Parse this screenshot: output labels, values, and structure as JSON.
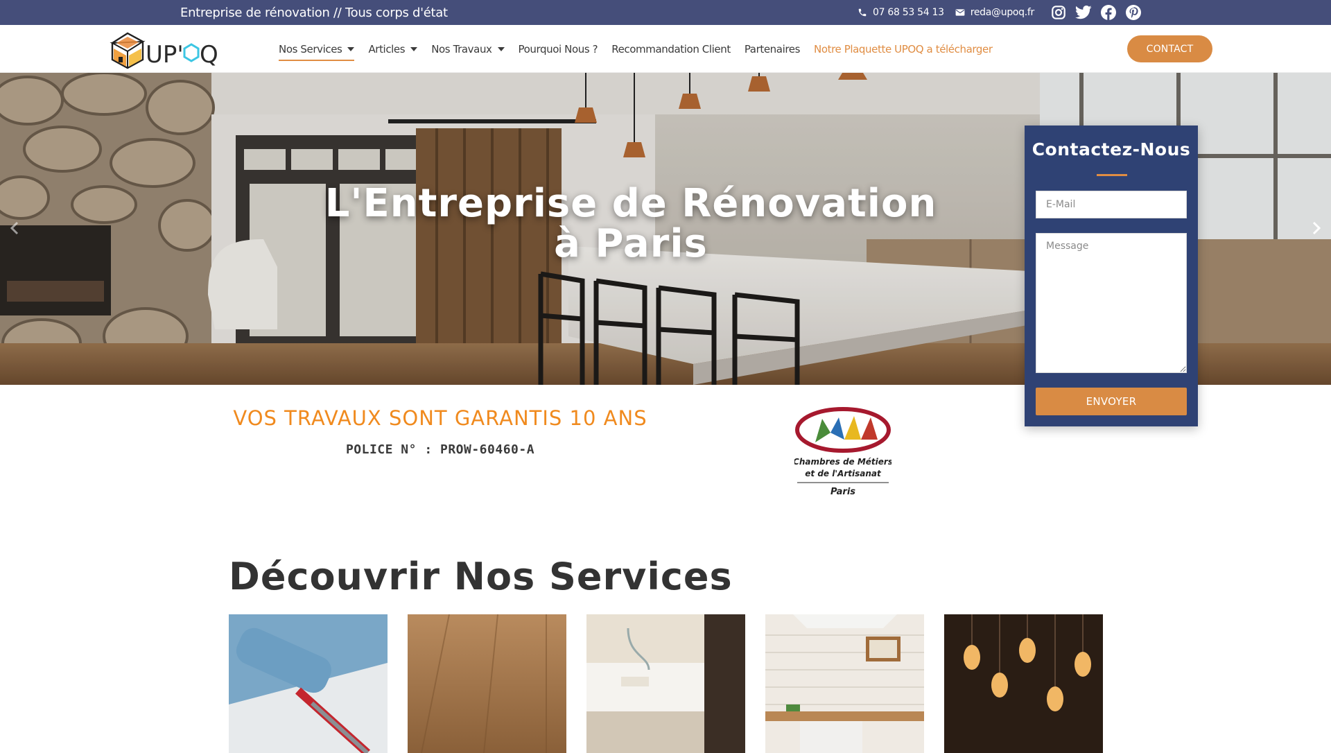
{
  "topbar": {
    "tagline": "Entreprise de rénovation // Tous corps d'état",
    "phone": "07 68 53 54 13",
    "email": "reda@upoq.fr",
    "socials": [
      "instagram-icon",
      "twitter-icon",
      "facebook-icon",
      "pinterest-icon"
    ]
  },
  "header": {
    "logo_text": "UP'OQ",
    "nav": [
      {
        "label": "Nos Services",
        "dropdown": true,
        "active": true
      },
      {
        "label": "Articles",
        "dropdown": true
      },
      {
        "label": "Nos Travaux",
        "dropdown": true
      },
      {
        "label": "Pourquoi Nous ?"
      },
      {
        "label": "Recommandation Client"
      },
      {
        "label": "Partenaires"
      },
      {
        "label": "Notre Plaquette UPOQ a télécharger",
        "highlight": true
      }
    ],
    "contact_label": "CONTACT"
  },
  "hero": {
    "title_line1": "L'Entreprise de Rénovation",
    "title_line2": "à Paris"
  },
  "contact_form": {
    "title": "Contactez-Nous",
    "email_placeholder": "E-Mail",
    "message_placeholder": "Message",
    "submit_label": "ENVOYER"
  },
  "guarantee": {
    "headline": "VOS TRAVAUX SONT GARANTIS 10 ANS",
    "policy": "POLICE N° : PROW-60460-A"
  },
  "cma_logo": {
    "line1": "Chambres de Métiers",
    "line2": "et de l'Artisanat",
    "city": "Paris"
  },
  "services": {
    "title": "Découvrir Nos Services",
    "tiles": [
      "painting",
      "flooring",
      "bathroom",
      "kitchen",
      "electricity"
    ]
  },
  "colors": {
    "topbar": "#454e7a",
    "accent": "#d98b44",
    "card": "#2f4274",
    "guarantee": "#f08a1e"
  }
}
